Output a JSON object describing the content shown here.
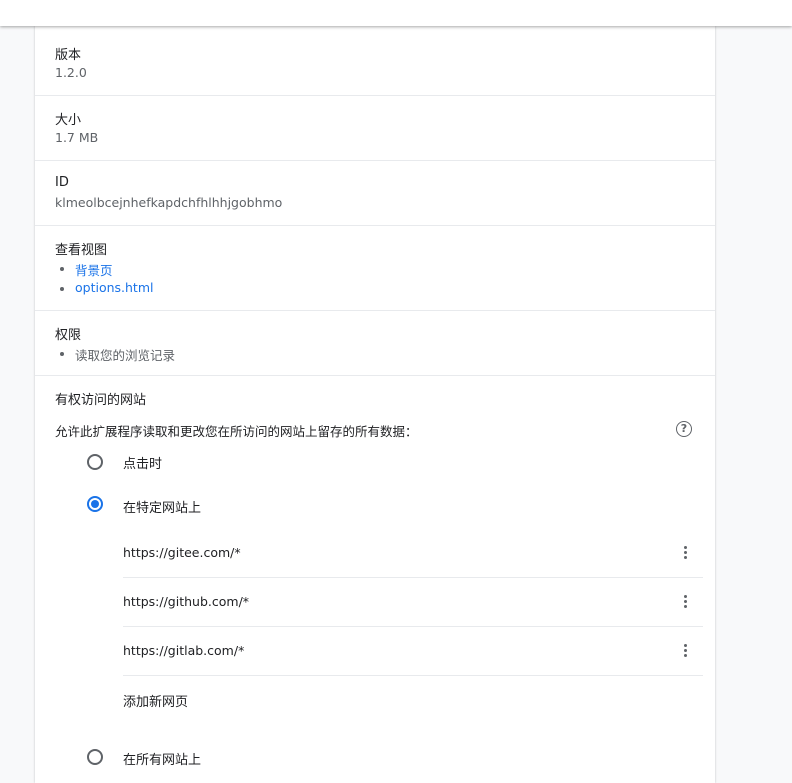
{
  "details": {
    "version": {
      "label": "版本",
      "value": "1.2.0"
    },
    "size": {
      "label": "大小",
      "value": "1.7 MB"
    },
    "id": {
      "label": "ID",
      "value": "klmeolbcejnhefkapdchfhlhhjgobhmo"
    },
    "views": {
      "label": "查看视图",
      "items": [
        "背景页",
        "options.html"
      ]
    },
    "permissions": {
      "label": "权限",
      "items": [
        "读取您的浏览记录"
      ]
    }
  },
  "site_access": {
    "title": "有权访问的网站",
    "description": "允许此扩展程序读取和更改您在所访问的网站上留存的所有数据：",
    "help_icon": "help-circle-icon",
    "options": [
      {
        "label": "点击时",
        "selected": false
      },
      {
        "label": "在特定网站上",
        "selected": true
      },
      {
        "label": "在所有网站上",
        "selected": false
      }
    ],
    "sites": [
      "https://gitee.com/*",
      "https://github.com/*",
      "https://gitlab.com/*"
    ],
    "add_site_label": "添加新网页"
  },
  "colors": {
    "accent": "#1a73e8",
    "text": "#202124",
    "secondary": "#5f6368",
    "divider": "#e8eaed"
  }
}
